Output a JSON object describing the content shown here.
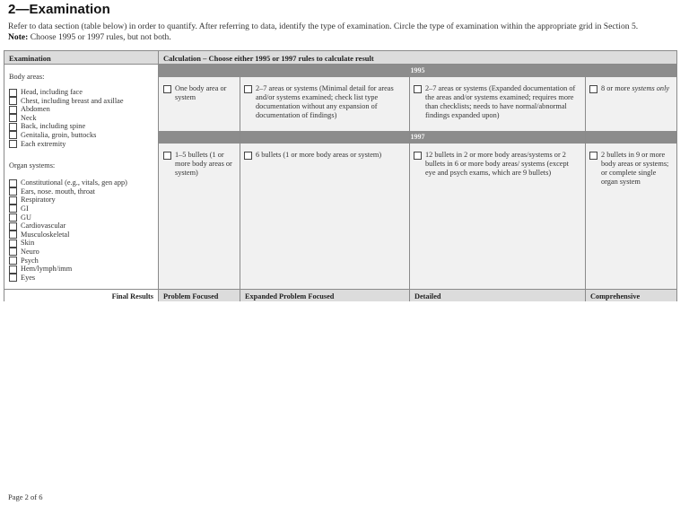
{
  "page": {
    "title": "2—Examination",
    "intro": "Refer to data section (table below) in order to quantify. After referring to data, identify the type of examination. Circle the type of examination within the appropriate grid in Section 5.",
    "note_label": "Note:",
    "note_text": " Choose 1995 or 1997 rules, but not both.",
    "page_number": "Page 2 of 6"
  },
  "table": {
    "left_header": "Examination",
    "right_header": "Calculation  – Choose either 1995 or 1997 rules to calculate result",
    "body_areas_label": "Body areas:",
    "body_areas": [
      "Head, including face",
      "Chest, including breast and axillae",
      "Abdomen",
      "Neck",
      "Back, including spine",
      "Genitalia, groin, buttocks",
      "Each extremity"
    ],
    "organ_systems_label": "Organ systems:",
    "organ_systems": [
      "Constitutional (e.g., vitals, gen app)",
      "Ears, nose. mouth, throat",
      "Respiratory",
      "GI",
      "GU",
      "Cardiovascular",
      "Musculoskeletal",
      "Skin",
      "Neuro",
      "Psych",
      "Hem/lymph/imm",
      "Eyes"
    ],
    "year_1995": "1995",
    "rules_1995": [
      "One body area or system",
      "2–7 areas or systems (Minimal detail for areas and/or systems examined; check list type documentation without any expansion of documentation of findings)",
      "2–7 areas or systems (Expanded documentation of the areas and/or systems examined; requires more than checklists; needs to have normal/abnormal findings expanded upon)",
      "8 or more "
    ],
    "rules_1995_last_italic": "systems only",
    "year_1997": "1997",
    "rules_1997": [
      "1–5 bullets (1 or more body areas or system)",
      "6 bullets (1 or more body areas or system)",
      "12 bullets in 2 or more body areas/systems or 2 bullets in 6 or more body areas/ systems (except eye and psych exams, which are 9 bullets)",
      "2 bullets in 9 or more body areas or systems; or complete single organ system"
    ],
    "final_results_label": "Final Results",
    "final_results": [
      "Problem Focused",
      "Expanded Problem Focused",
      "Detailed",
      "Comprehensive"
    ]
  }
}
